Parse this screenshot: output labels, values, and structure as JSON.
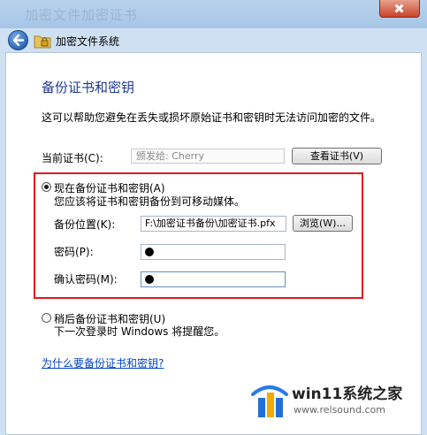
{
  "window": {
    "title_ghost": "加密文件加密证书"
  },
  "nav": {
    "title": "加密文件系统"
  },
  "page": {
    "heading": "备份证书和密钥",
    "intro": "这可以帮助您避免在丢失或损坏原始证书和密钥时无法访问加密的文件。"
  },
  "current_cert": {
    "label": "当前证书(C):",
    "value": "颁发给:  Cherry",
    "view_button": "查看证书(V)"
  },
  "backup_now": {
    "label": "现在备份证书和密钥(A)",
    "description": "您应该将证书和密钥备份到可移动媒体。",
    "selected": true,
    "location_label": "备份位置(K):",
    "location_value": "F:\\加密证书备份\\加密证书.pfx",
    "browse_button": "浏览(W)...",
    "password_label": "密码(P):",
    "confirm_label": "确认密码(M):"
  },
  "backup_later": {
    "label": "稍后备份证书和密钥(U)",
    "description": "下一次登录时 Windows 将提醒您。",
    "selected": false
  },
  "help_link": "为什么要备份证书和密钥?",
  "watermark": {
    "title": "win11系统之家",
    "url": "www.relsound.com"
  },
  "colors": {
    "accent_heading": "#1f3a93",
    "highlight_border": "#e0171b",
    "link": "#0645c8"
  }
}
